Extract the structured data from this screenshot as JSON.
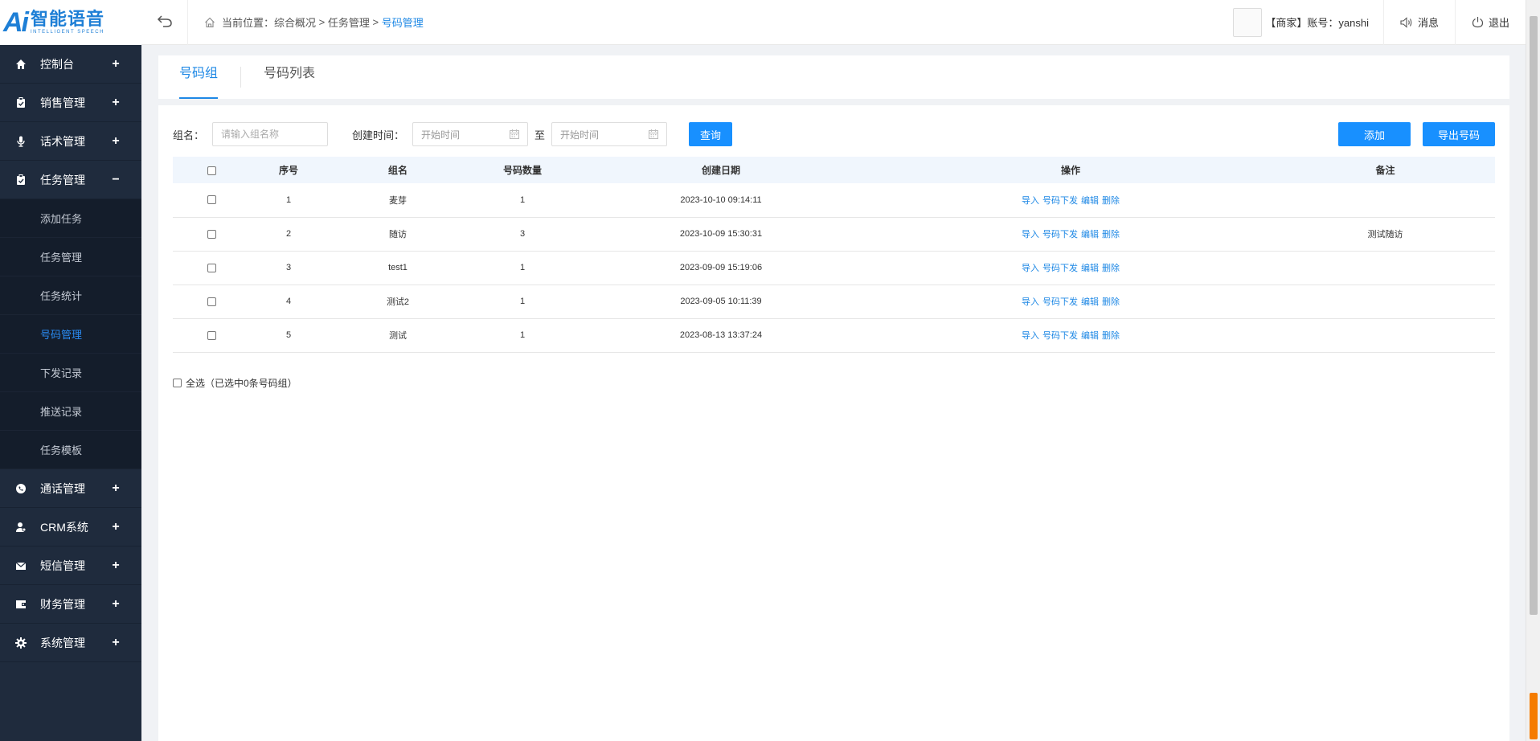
{
  "logo": {
    "ai": "Ai",
    "title": "智能语音",
    "subtitle": "INTELLIGENT SPEECH"
  },
  "sidebar": {
    "items": [
      {
        "label": "控制台",
        "icon": "home-icon",
        "sign": "+"
      },
      {
        "label": "销售管理",
        "icon": "clipboard-icon",
        "sign": "+"
      },
      {
        "label": "话术管理",
        "icon": "microphone-icon",
        "sign": "+"
      },
      {
        "label": "任务管理",
        "icon": "clipboard-icon",
        "sign": "−"
      }
    ],
    "sub_items": [
      {
        "label": "添加任务"
      },
      {
        "label": "任务管理"
      },
      {
        "label": "任务统计"
      },
      {
        "label": "号码管理"
      },
      {
        "label": "下发记录"
      },
      {
        "label": "推送记录"
      },
      {
        "label": "任务模板"
      }
    ],
    "items_after": [
      {
        "label": "通话管理",
        "icon": "phone-icon",
        "sign": "+"
      },
      {
        "label": "CRM系统",
        "icon": "user-icon",
        "sign": "+"
      },
      {
        "label": "短信管理",
        "icon": "mail-icon",
        "sign": "+"
      },
      {
        "label": "财务管理",
        "icon": "wallet-icon",
        "sign": "+"
      },
      {
        "label": "系统管理",
        "icon": "gear-icon",
        "sign": "+"
      }
    ]
  },
  "header": {
    "breadcrumb_prefix": "当前位置：",
    "crumb1": "综合概况",
    "sep": " > ",
    "crumb2": "任务管理",
    "crumb3": "号码管理",
    "user_text": "【商家】账号：yanshi",
    "message_label": "消息",
    "logout_label": "退出"
  },
  "tabs": [
    {
      "label": "号码组"
    },
    {
      "label": "号码列表"
    }
  ],
  "filter": {
    "group_label": "组名：",
    "group_placeholder": "请输入组名称",
    "created_label": "创建时间：",
    "start_placeholder": "开始时间",
    "to_label": "至",
    "end_placeholder": "开始时间",
    "query_label": "查询",
    "add_label": "添加",
    "export_label": "导出号码"
  },
  "table": {
    "columns": [
      "序号",
      "组名",
      "号码数量",
      "创建日期",
      "操作",
      "备注"
    ],
    "actions": [
      "导入",
      "号码下发",
      "编辑",
      "删除"
    ],
    "rows": [
      {
        "no": "1",
        "name": "麦芽",
        "count": "1",
        "date": "2023-10-10 09:14:11",
        "remark": ""
      },
      {
        "no": "2",
        "name": "随访",
        "count": "3",
        "date": "2023-10-09 15:30:31",
        "remark": "测试随访"
      },
      {
        "no": "3",
        "name": "test1",
        "count": "1",
        "date": "2023-09-09 15:19:06",
        "remark": ""
      },
      {
        "no": "4",
        "name": "测试2",
        "count": "1",
        "date": "2023-09-05 10:11:39",
        "remark": ""
      },
      {
        "no": "5",
        "name": "测试",
        "count": "1",
        "date": "2023-08-13 13:37:24",
        "remark": ""
      }
    ]
  },
  "select_all": "全选（已选中0条号码组）"
}
